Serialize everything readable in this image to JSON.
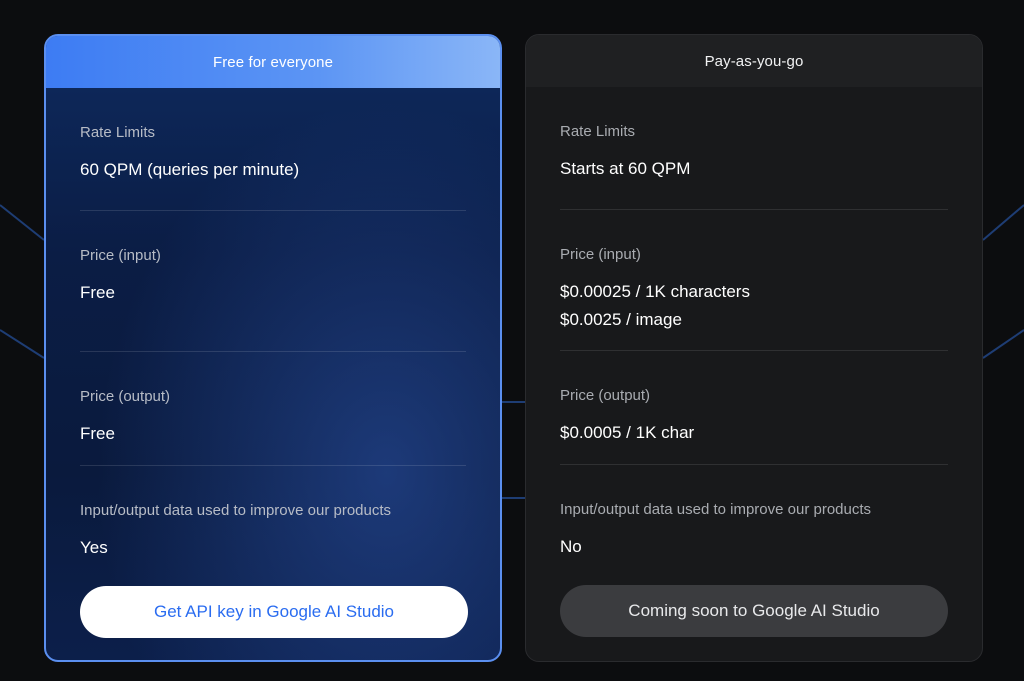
{
  "plans": [
    {
      "header": "Free for everyone",
      "rate_limits": {
        "label": "Rate Limits",
        "value": "60 QPM (queries per minute)"
      },
      "price_input": {
        "label": "Price (input)",
        "value_lines": [
          "Free"
        ]
      },
      "price_output": {
        "label": "Price (output)",
        "value": "Free"
      },
      "data_usage": {
        "label": "Input/output data used to improve our products",
        "value": "Yes"
      },
      "cta_label": "Get API key in Google AI Studio"
    },
    {
      "header": "Pay-as-you-go",
      "rate_limits": {
        "label": "Rate Limits",
        "value": "Starts at 60 QPM"
      },
      "price_input": {
        "label": "Price (input)",
        "value_lines": [
          "$0.00025 / 1K characters",
          "$0.0025 / image"
        ]
      },
      "price_output": {
        "label": "Price (output)",
        "value": "$0.0005 / 1K char"
      },
      "data_usage": {
        "label": "Input/output data used to improve our products",
        "value": "No"
      },
      "cta_label": "Coming soon to Google AI Studio"
    }
  ],
  "colors": {
    "accent_blue": "#3d7cf3",
    "free_card_border": "#5b8ff0",
    "paid_card_bg": "#18191b",
    "page_bg": "#0c0d0f"
  }
}
